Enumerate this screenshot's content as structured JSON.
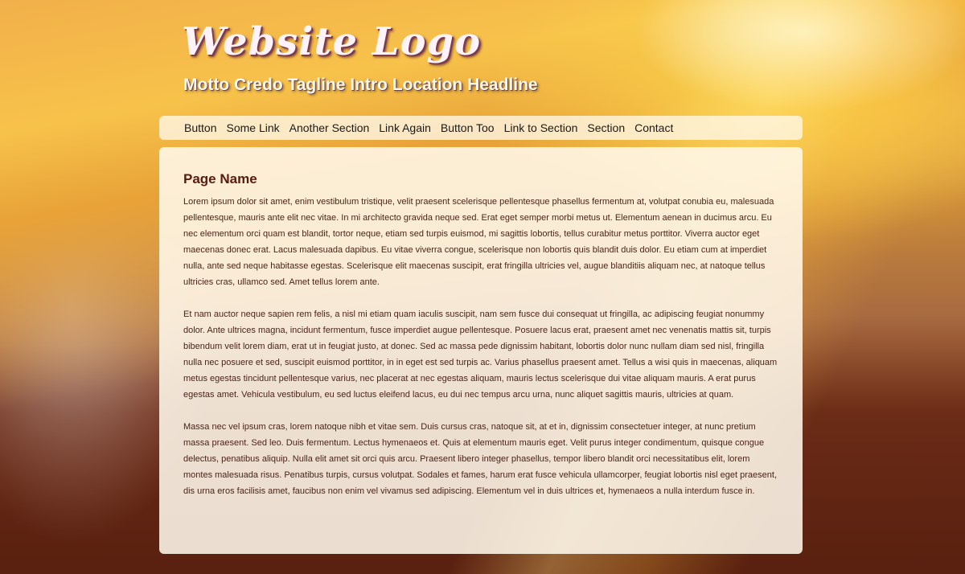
{
  "header": {
    "logo": "Website Logo",
    "tagline": "Motto Credo Tagline Intro Location Headline"
  },
  "nav": {
    "items": [
      {
        "label": "Button"
      },
      {
        "label": "Some Link"
      },
      {
        "label": "Another Section"
      },
      {
        "label": "Link Again"
      },
      {
        "label": "Button Too"
      },
      {
        "label": "Link to Section"
      },
      {
        "label": "Section"
      },
      {
        "label": "Contact"
      }
    ]
  },
  "main": {
    "title": "Page Name",
    "paragraphs": [
      "Lorem ipsum dolor sit amet, enim vestibulum tristique, velit praesent scelerisque pellentesque phasellus fermentum at, volutpat conubia eu, malesuada pellentesque, mauris ante elit nec vitae. In mi architecto gravida neque sed. Erat eget semper morbi metus ut. Elementum aenean in ducimus arcu. Eu nec elementum orci quam est blandit, tortor neque, etiam sed turpis euismod, mi sagittis lobortis, tellus curabitur metus porttitor. Viverra auctor eget maecenas donec erat. Lacus malesuada dapibus. Eu vitae viverra congue, scelerisque non lobortis quis blandit duis dolor. Eu etiam cum at imperdiet nulla, ante sed neque habitasse egestas. Scelerisque elit maecenas suscipit, erat fringilla ultricies vel, augue blanditiis aliquam nec, at natoque tellus ultricies cras, ullamco sed. Amet tellus lorem ante.",
      "Et nam auctor neque sapien rem felis, a nisl mi etiam quam iaculis suscipit, nam sem fusce dui consequat ut fringilla, ac adipiscing feugiat nonummy dolor. Ante ultrices magna, incidunt fermentum, fusce imperdiet augue pellentesque. Posuere lacus erat, praesent amet nec venenatis mattis sit, turpis bibendum velit lorem diam, erat ut in feugiat justo, at donec. Sed ac massa pede dignissim habitant, lobortis dolor nunc nullam diam sed nisl, fringilla nulla nec posuere et sed, suscipit euismod porttitor, in in eget est sed turpis ac. Varius phasellus praesent amet. Tellus a wisi quis in maecenas, aliquam metus egestas tincidunt pellentesque varius, nec placerat at nec egestas aliquam, mauris lectus scelerisque dui vitae aliquam mauris. A erat purus egestas amet. Vehicula vestibulum, eu sed luctus eleifend lacus, eu dui nec tempus arcu urna, nunc aliquet sagittis mauris, ultricies at quam.",
      "Massa nec vel ipsum cras, lorem natoque nibh et vitae sem. Duis cursus cras, natoque sit, at et in, dignissim consectetuer integer, at nunc pretium massa praesent. Sed leo. Duis fermentum. Lectus hymenaeos et. Quis at elementum mauris eget. Velit purus integer condimentum, quisque congue delectus, penatibus aliquip. Nulla elit amet sit orci quis arcu. Praesent libero integer phasellus, tempor libero blandit orci necessitatibus elit, lorem montes malesuada risus. Penatibus turpis, cursus volutpat. Sodales et fames, harum erat fusce vehicula ullamcorper, feugiat lobortis nisl eget praesent, dis urna eros facilisis amet, faucibus non enim vel vivamus sed adipiscing. Elementum vel in duis ultrices et, hymenaeos a nulla interdum fusce in."
    ]
  },
  "colors": {
    "sky": "#f3c24e",
    "sand": "#5a2210",
    "panel": "#fff8eb",
    "title": "#5a1a10",
    "body_text": "#4a2418"
  }
}
